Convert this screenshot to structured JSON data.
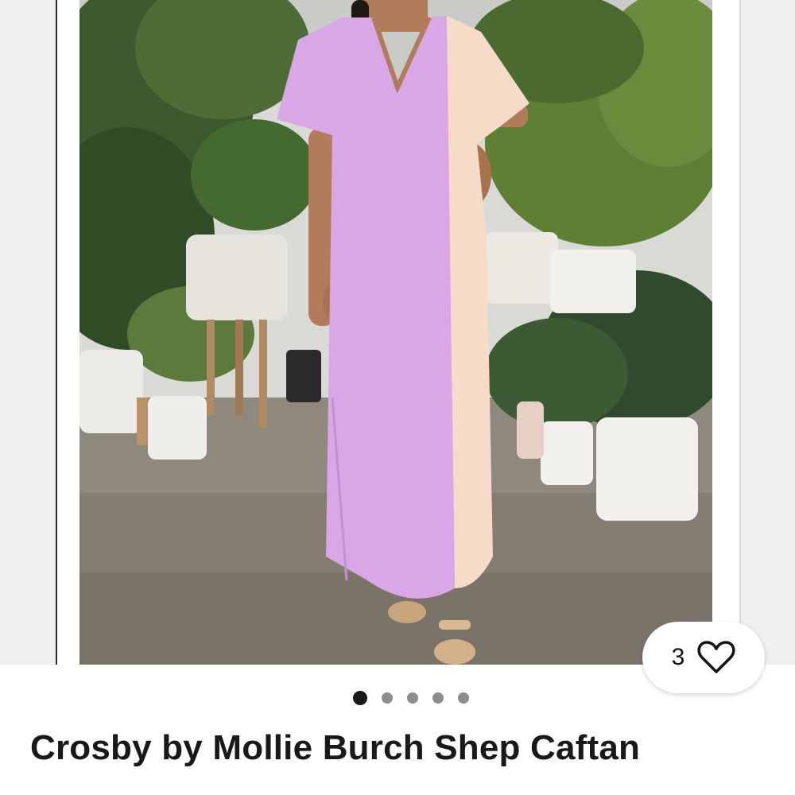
{
  "listing": {
    "title": "Crosby by Mollie Burch Shep Caftan",
    "photo_alt": "Woman wearing pink and peach color-block maxi caftan among potted plants"
  },
  "like": {
    "count": "3",
    "icon": "heart-icon"
  },
  "gallery": {
    "image_count": 5,
    "active_index": 0
  },
  "colors": {
    "caftan_pink": "#d9a7e6",
    "caftan_peach": "#f6dcc8",
    "text": "#191919",
    "dot_inactive": "#8c8c8c",
    "dot_active": "#191919"
  }
}
